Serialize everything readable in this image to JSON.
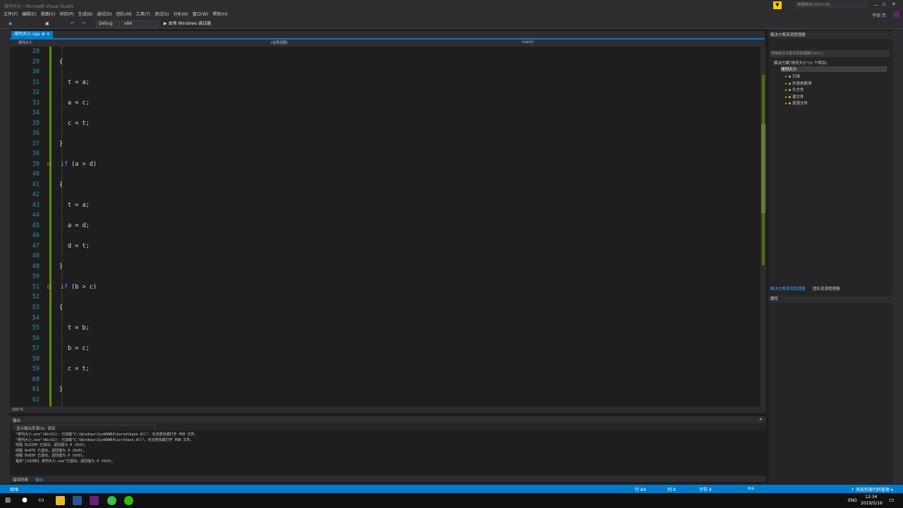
{
  "window": {
    "title": "排列大小 - Microsoft Visual Studio",
    "quick_launch": "快速启动 (Ctrl+Q)",
    "user": "子玥 杰"
  },
  "menu": [
    "文件(F)",
    "编辑(E)",
    "视图(V)",
    "项目(P)",
    "生成(B)",
    "调试(D)",
    "团队(M)",
    "工具(T)",
    "测试(S)",
    "分析(N)",
    "窗口(W)",
    "帮助(H)"
  ],
  "toolbar": {
    "config": "Debug",
    "platform": "x86",
    "run_label": "▶ 本地 Windows 调试器"
  },
  "editor": {
    "tab_label": "排列大小.cpp",
    "nav_project": "排列大小",
    "nav_scope": "(全局范围)",
    "nav_func": "main()",
    "zoom": "100 %",
    "lines": [
      {
        "n": "28",
        "t": ""
      },
      {
        "n": "29",
        "t": "{"
      },
      {
        "n": "30",
        "t": ""
      },
      {
        "n": "31",
        "t": "t = a;"
      },
      {
        "n": "32",
        "t": ""
      },
      {
        "n": "33",
        "t": "a = c;"
      },
      {
        "n": "34",
        "t": ""
      },
      {
        "n": "35",
        "t": "c = t;"
      },
      {
        "n": "36",
        "t": ""
      },
      {
        "n": "37",
        "t": "}"
      },
      {
        "n": "38",
        "t": ""
      },
      {
        "n": "39",
        "kw": "if",
        "t": " (a > d)"
      },
      {
        "n": "40",
        "t": ""
      },
      {
        "n": "41",
        "t": "{"
      },
      {
        "n": "42",
        "t": ""
      },
      {
        "n": "43",
        "t": "t = a;"
      },
      {
        "n": "44",
        "t": ""
      },
      {
        "n": "45",
        "t": "a = d;"
      },
      {
        "n": "46",
        "t": ""
      },
      {
        "n": "47",
        "t": "d = t;"
      },
      {
        "n": "48",
        "t": ""
      },
      {
        "n": "49",
        "t": "}"
      },
      {
        "n": "50",
        "t": ""
      },
      {
        "n": "51",
        "kw": "if",
        "t": " (b > c)"
      },
      {
        "n": "52",
        "t": ""
      },
      {
        "n": "53",
        "t": "{"
      },
      {
        "n": "54",
        "t": ""
      },
      {
        "n": "55",
        "t": "t = b;"
      },
      {
        "n": "56",
        "t": ""
      },
      {
        "n": "57",
        "t": "b = c;"
      },
      {
        "n": "58",
        "t": ""
      },
      {
        "n": "59",
        "t": "c = t;"
      },
      {
        "n": "60",
        "t": ""
      },
      {
        "n": "61",
        "t": "}"
      },
      {
        "n": "62",
        "t": ""
      }
    ]
  },
  "output": {
    "title": "输出",
    "source_label": "显示输出来源(S): 调试",
    "lines": [
      "\"排列大小.exe\"(Win32): 已加载\"C:\\Windows\\SysWOW64\\kernelbase.dll\"。无法查找或打开 PDB 文件。",
      "\"排列大小.exe\"(Win32): 已加载\"C:\\Windows\\SysWOW64\\ucrtbase.dll\"。无法查找或打开 PDB 文件。",
      "线程 0x2294 已退出，返回值为 0 (0x0)。",
      "线程 0x474 已退出，返回值为 0 (0x0)。",
      "线程 0x830 已退出，返回值为 0 (0x0)。",
      "程序\"[10288] 排列大小.exe\"已退出，返回值为 0 (0x0)。"
    ],
    "tabs": [
      "错误列表",
      "输出"
    ]
  },
  "solution_explorer": {
    "title": "解决方案资源管理器",
    "search": "搜索解决方案资源管理器(Ctrl+;)",
    "solution": "解决方案\"排列大小\"(1 个项目)",
    "project": "排列大小",
    "items": [
      "引用",
      "外部依赖项",
      "头文件",
      "源文件",
      "资源文件"
    ],
    "tabs": [
      "解决方案资源管理器",
      "团队资源管理器"
    ]
  },
  "properties": {
    "title": "属性"
  },
  "status": {
    "ready": "就绪",
    "row": "行 84",
    "col": "列 9",
    "char": "字符 9",
    "mode": "Ins",
    "source_control": "↑ 添加到源代码管理 ▾"
  },
  "taskbar": {
    "time": "12:34",
    "date": "2019/5/16",
    "lang": "ENG"
  }
}
